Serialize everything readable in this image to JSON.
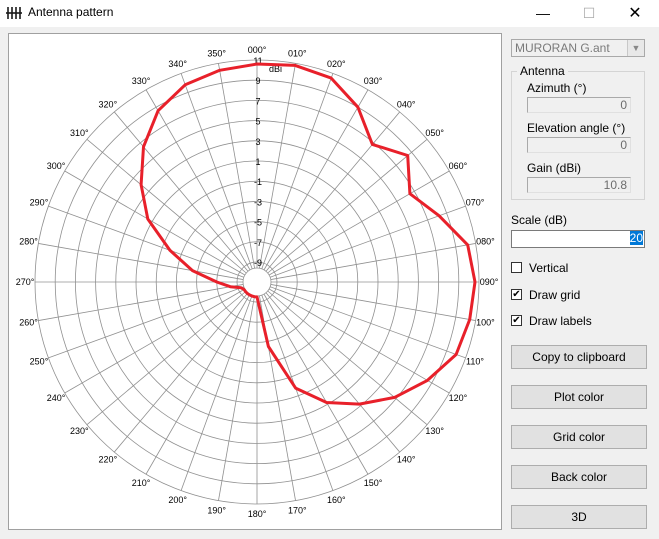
{
  "window": {
    "title": "Antenna pattern",
    "minimize": "—",
    "maximize": "☐",
    "close": "✕"
  },
  "antenna_file": "MURORAN  G.ant",
  "antenna_group": {
    "title": "Antenna",
    "azimuth_label": "Azimuth (°)",
    "azimuth_value": "0",
    "elevation_label": "Elevation angle (°)",
    "elevation_value": "0",
    "gain_label": "Gain (dBi)",
    "gain_value": "10.8"
  },
  "scale": {
    "label": "Scale (dB)",
    "value": "20"
  },
  "checkboxes": [
    {
      "label": "Vertical",
      "checked": false
    },
    {
      "label": "Draw grid",
      "checked": true
    },
    {
      "label": "Draw labels",
      "checked": true
    }
  ],
  "buttons": {
    "copy": "Copy to clipboard",
    "plot_color": "Plot color",
    "grid_color": "Grid color",
    "back_color": "Back color",
    "three_d": "3D"
  },
  "colors": {
    "plot": "#e8202a",
    "grid": "#909090",
    "background": "#ffffff"
  },
  "chart_data": {
    "type": "polar",
    "units_label": "dBi",
    "ring_labels": [
      "11",
      "9",
      "7",
      "5",
      "3",
      "1",
      "-1",
      "-3",
      "-5",
      "-7",
      "-9"
    ],
    "angle_labels": [
      "000",
      "010",
      "020",
      "030",
      "040",
      "050",
      "060",
      "070",
      "080",
      "090",
      "100",
      "110",
      "120",
      "130",
      "140",
      "150",
      "160",
      "170",
      "180",
      "190",
      "200",
      "210",
      "220",
      "230",
      "240",
      "250",
      "260",
      "270",
      "280",
      "290",
      "300",
      "310",
      "320",
      "330",
      "340",
      "350"
    ],
    "scale_db": 20,
    "max_db": 11,
    "pattern": [
      {
        "az": 0,
        "db": 10.6
      },
      {
        "az": 10,
        "db": 10.8
      },
      {
        "az": 20,
        "db": 10.5
      },
      {
        "az": 30,
        "db": 9.0
      },
      {
        "az": 40,
        "db": 6.8
      },
      {
        "az": 50,
        "db": 8.5
      },
      {
        "az": 60,
        "db": 6.5
      },
      {
        "az": 70,
        "db": 8.2
      },
      {
        "az": 80,
        "db": 10.2
      },
      {
        "az": 90,
        "db": 10.6
      },
      {
        "az": 100,
        "db": 10.4
      },
      {
        "az": 110,
        "db": 10.0
      },
      {
        "az": 120,
        "db": 8.5
      },
      {
        "az": 130,
        "db": 6.8
      },
      {
        "az": 140,
        "db": 4.8
      },
      {
        "az": 150,
        "db": 2.8
      },
      {
        "az": 160,
        "db": 0.2
      },
      {
        "az": 170,
        "db": -4.5
      },
      {
        "az": 180,
        "db": -9.5
      },
      {
        "az": 190,
        "db": -9.5
      },
      {
        "az": 200,
        "db": -9.5
      },
      {
        "az": 210,
        "db": -9.5
      },
      {
        "az": 220,
        "db": -9.5
      },
      {
        "az": 230,
        "db": -9.5
      },
      {
        "az": 240,
        "db": -9.5
      },
      {
        "az": 250,
        "db": -9.3
      },
      {
        "az": 260,
        "db": -8.3
      },
      {
        "az": 270,
        "db": -7.0
      },
      {
        "az": 280,
        "db": -4.5
      },
      {
        "az": 290,
        "db": -1.8
      },
      {
        "az": 300,
        "db": 1.5
      },
      {
        "az": 310,
        "db": 4.0
      },
      {
        "az": 320,
        "db": 6.5
      },
      {
        "az": 330,
        "db": 8.6
      },
      {
        "az": 340,
        "db": 9.8
      },
      {
        "az": 350,
        "db": 10.3
      }
    ]
  }
}
